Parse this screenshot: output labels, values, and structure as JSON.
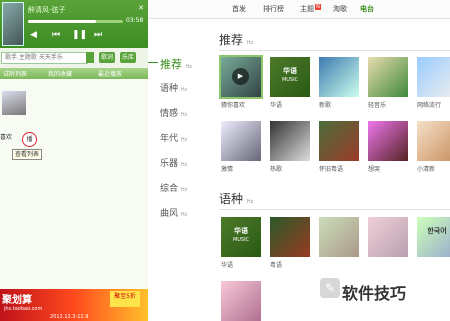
{
  "player": {
    "track_title": "醉清风-弦子",
    "time_elapsed": "03:58",
    "progress": 0.72,
    "controls": {
      "prev": "⏮",
      "play": "❚❚",
      "next": "⏭",
      "volume": "◀"
    },
    "window_controls": "✕",
    "search": {
      "placeholder": "歌手.主题歌 天天手乐",
      "lyrics_label": "歌词",
      "library_label": "乐库"
    },
    "list_tabs": [
      "试听列表",
      "我的收藏",
      "最近播放"
    ],
    "now_playing": {
      "like_label": "喜欢",
      "circle_label": "播",
      "tooltip": "查看列表"
    },
    "ad": {
      "left_text": "聚划算",
      "right_text": "聚至5折",
      "domain": "jhs.taobao.com",
      "date": "2012.12.3-12.9"
    }
  },
  "topnav": {
    "items": [
      {
        "label": "首发",
        "active": false
      },
      {
        "label": "排行榜",
        "active": false
      },
      {
        "label": "主题",
        "active": false,
        "badge": "N"
      },
      {
        "label": "淘歌",
        "active": false
      },
      {
        "label": "电台",
        "active": true
      }
    ]
  },
  "categories": [
    {
      "label": "推荐",
      "sub": "Hz",
      "active": true
    },
    {
      "label": "语种",
      "sub": "Hz",
      "active": false
    },
    {
      "label": "情感",
      "sub": "Hz",
      "active": false
    },
    {
      "label": "年代",
      "sub": "Hz",
      "active": false
    },
    {
      "label": "乐器",
      "sub": "Hz",
      "active": false
    },
    {
      "label": "综合",
      "sub": "Hz",
      "active": false
    },
    {
      "label": "曲风",
      "sub": "Hz",
      "active": false
    }
  ],
  "sections": {
    "recommend": {
      "title": "推荐",
      "sub": "Hz",
      "stations": [
        {
          "label": "猜你喜欢",
          "overlay": ""
        },
        {
          "label": "华语",
          "overlay": "华语",
          "overlay_sub": "MUSIC"
        },
        {
          "label": "新歌",
          "overlay": ""
        },
        {
          "label": "轻音乐",
          "overlay": ""
        },
        {
          "label": "网络流行",
          "overlay": ""
        },
        {
          "label": "激情",
          "overlay": ""
        },
        {
          "label": "热歌",
          "overlay": ""
        },
        {
          "label": "怀旧粤语",
          "overlay": ""
        },
        {
          "label": "想哭",
          "overlay": ""
        },
        {
          "label": "小清新",
          "overlay": ""
        }
      ]
    },
    "language": {
      "title": "语种",
      "sub": "Hz",
      "stations": [
        {
          "label": "华语",
          "overlay": "华语",
          "overlay_sub": "MUSIC"
        },
        {
          "label": "粤语",
          "overlay": ""
        },
        {
          "label": "",
          "overlay": ""
        },
        {
          "label": "",
          "overlay": ""
        },
        {
          "label": "",
          "overlay": "한국어"
        },
        {
          "label": "",
          "overlay": ""
        }
      ]
    }
  },
  "watermark": {
    "text": "软件技巧",
    "logo": "✎"
  }
}
